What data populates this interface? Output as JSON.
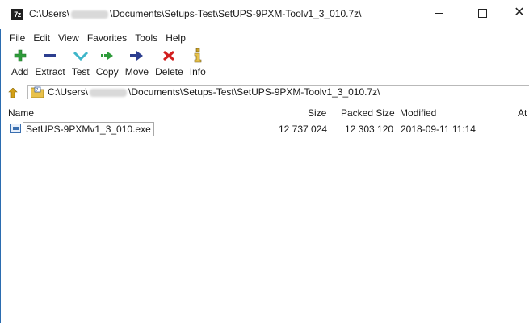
{
  "window": {
    "app_icon_text": "7z",
    "title_prefix": "C:\\Users\\",
    "title_suffix": "\\Documents\\Setups-Test\\SetUPS-9PXM-Toolv1_3_010.7z\\"
  },
  "menu": [
    "File",
    "Edit",
    "View",
    "Favorites",
    "Tools",
    "Help"
  ],
  "toolbar": {
    "add": {
      "label": "Add",
      "icon": "plus-icon",
      "color": "#2e9b3a"
    },
    "extract": {
      "label": "Extract",
      "icon": "minus-icon",
      "color": "#2c3e8f"
    },
    "test": {
      "label": "Test",
      "icon": "check-icon",
      "color": "#3fb6c9"
    },
    "copy": {
      "label": "Copy",
      "icon": "copy-arrow-icon",
      "color": "#2e9b3a"
    },
    "move": {
      "label": "Move",
      "icon": "move-arrow-icon",
      "color": "#2c3e8f"
    },
    "delete": {
      "label": "Delete",
      "icon": "x-icon",
      "color": "#d21f1f"
    },
    "info": {
      "label": "Info",
      "icon": "info-icon",
      "color": "#c9a227"
    }
  },
  "address": {
    "path_prefix": "C:\\Users\\",
    "path_suffix": "\\Documents\\Setups-Test\\SetUPS-9PXM-Toolv1_3_010.7z\\"
  },
  "columns": {
    "name": "Name",
    "size": "Size",
    "packed": "Packed Size",
    "modified": "Modified",
    "attributes": "At"
  },
  "files": [
    {
      "name": "SetUPS-9PXMv1_3_010.exe",
      "size": "12 737 024",
      "packed": "12 303 120",
      "modified": "2018-09-11 11:14"
    }
  ]
}
